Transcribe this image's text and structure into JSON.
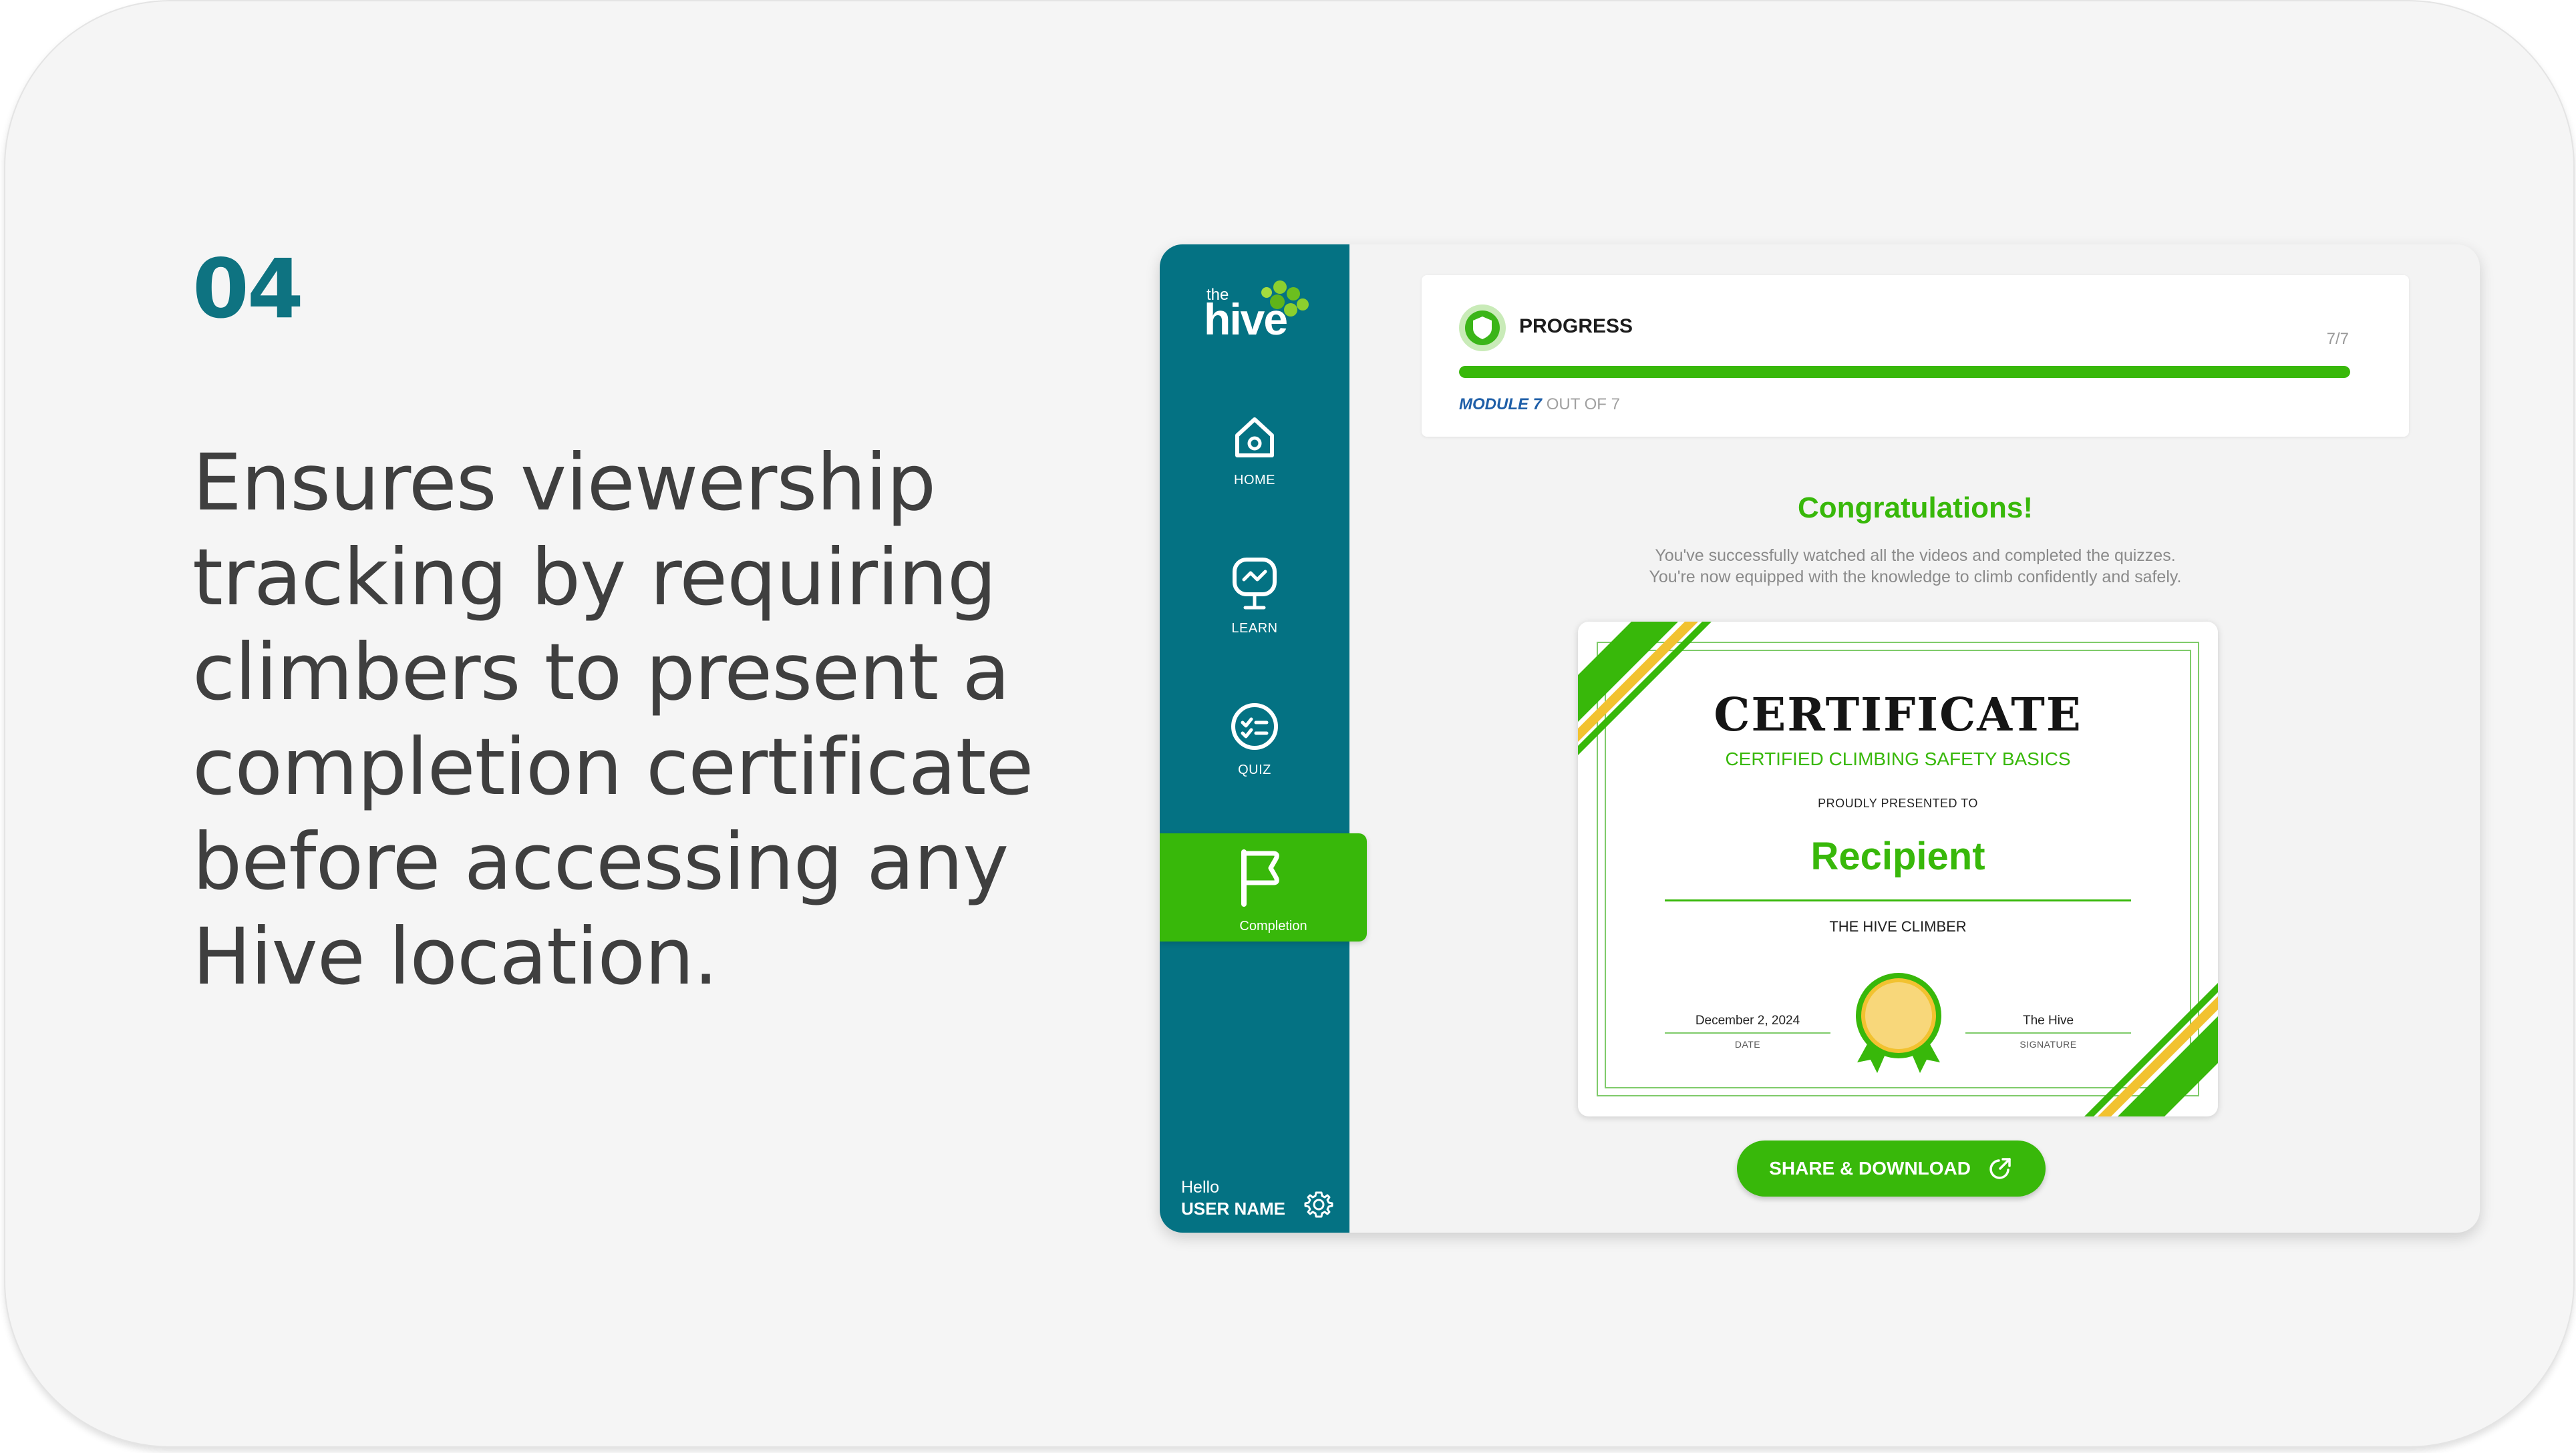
{
  "slide": {
    "step_number": "04",
    "description": "Ensures viewership tracking by requiring climbers to present a completion certificate before accessing any Hive location."
  },
  "app": {
    "logo": {
      "prefix": "the",
      "name": "hive"
    },
    "nav": {
      "home": "HOME",
      "learn": "LEARN",
      "quiz": "QUIZ",
      "completion": "Completion"
    },
    "user": {
      "greeting": "Hello",
      "name": "USER NAME"
    },
    "progress": {
      "title": "PROGRESS",
      "count": "7/7",
      "fraction": 1.0,
      "module_label": "MODULE 7",
      "module_total": "OUT OF 7"
    },
    "congrats": {
      "title": "Congratulations!",
      "line1": "You've successfully watched all the videos and completed the quizzes.",
      "line2": "You're now equipped with the knowledge to climb confidently and safely."
    },
    "certificate": {
      "title": "CERTIFICATE",
      "subtitle": "CERTIFIED CLIMBING SAFETY BASICS",
      "presented": "PROUDLY PRESENTED TO",
      "recipient": "Recipient",
      "climber": "THE HIVE CLIMBER",
      "date_value": "December 2, 2024",
      "date_label": "DATE",
      "signature_value": "The Hive",
      "signature_label": "SIGNATURE"
    },
    "share_button": "SHARE & DOWNLOAD",
    "colors": {
      "teal": "#047283",
      "green": "#38b80a",
      "step_number": "#0e7381",
      "ribbon_yellow": "#f2c230"
    },
    "icons": [
      "home-icon",
      "learn-icon",
      "quiz-icon",
      "flag-icon",
      "gear-icon",
      "shield-icon",
      "external-link-icon",
      "seal-icon"
    ]
  }
}
